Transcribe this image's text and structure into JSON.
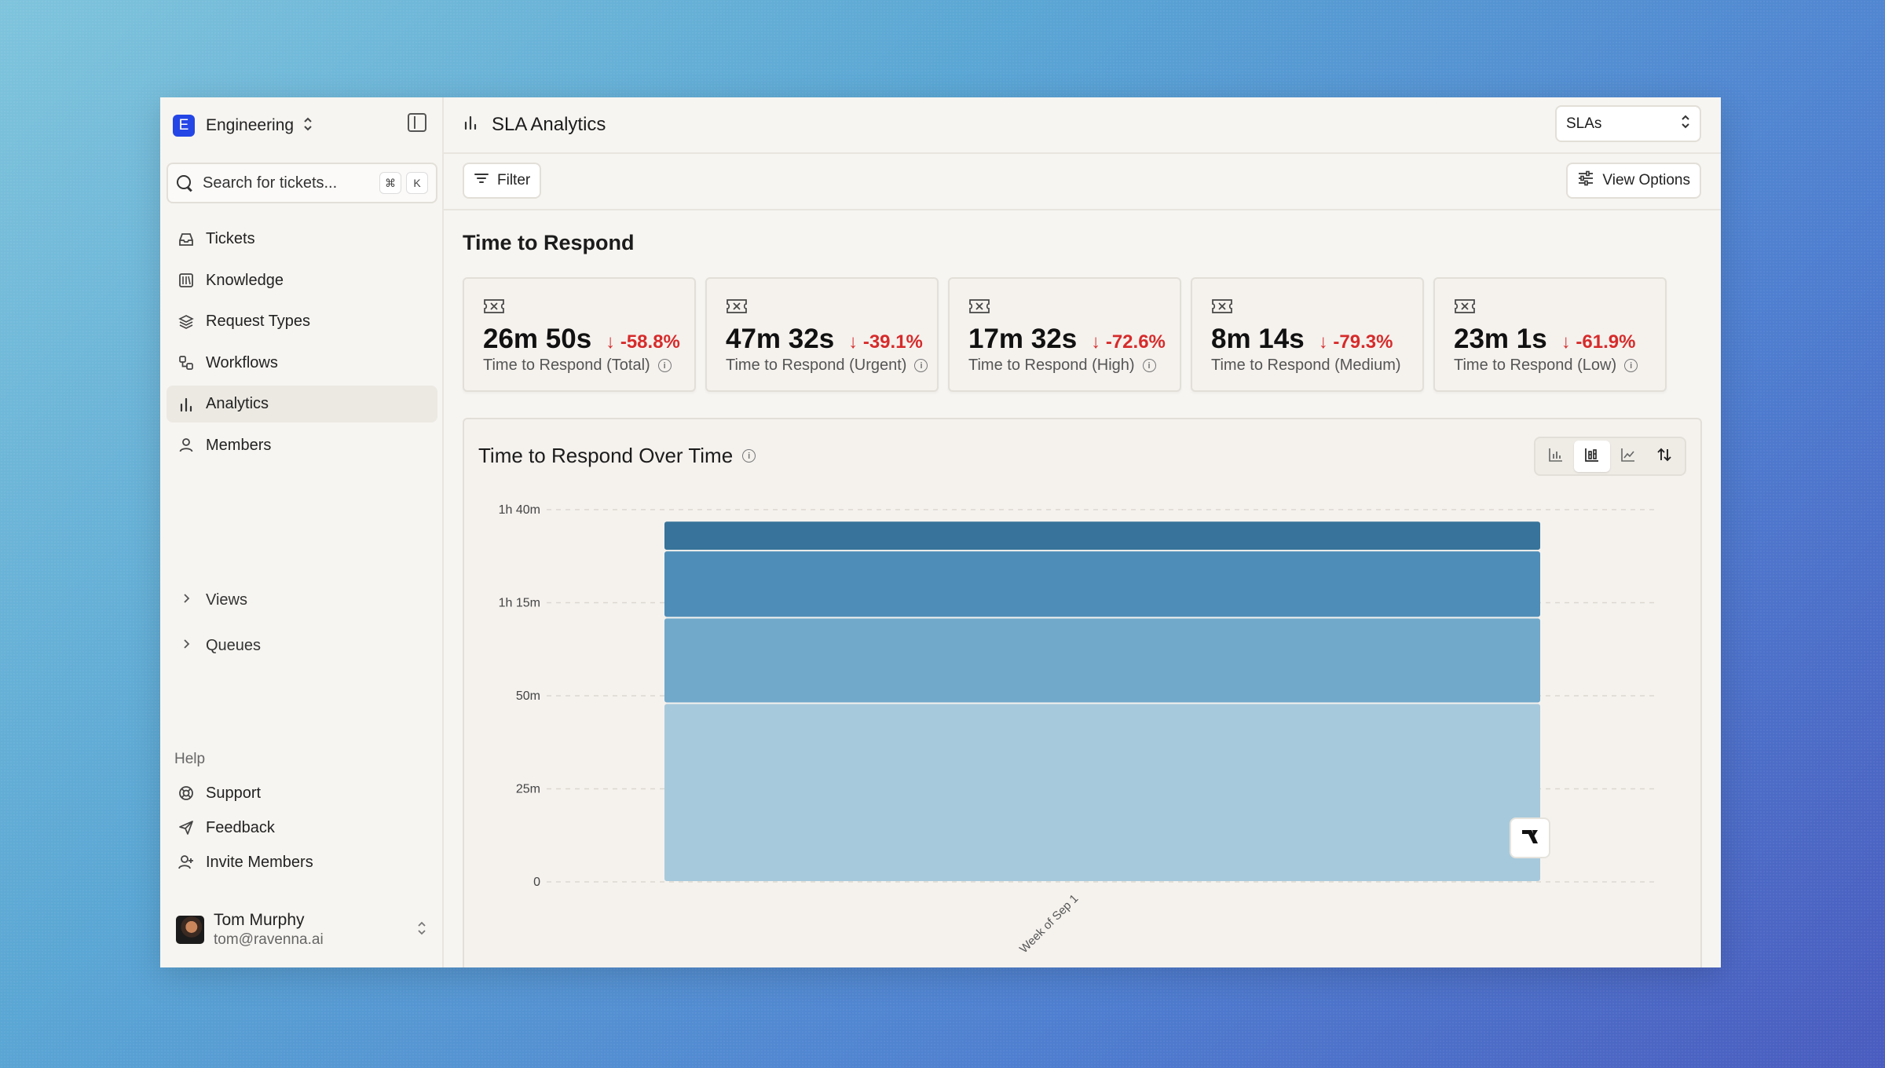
{
  "workspace": {
    "initial": "E",
    "name": "Engineering"
  },
  "search": {
    "placeholder": "Search for tickets...",
    "shortcut_mod": "⌘",
    "shortcut_key": "K"
  },
  "nav": {
    "items": [
      {
        "label": "Tickets",
        "icon": "inbox-icon"
      },
      {
        "label": "Knowledge",
        "icon": "book-icon"
      },
      {
        "label": "Request Types",
        "icon": "layers-icon"
      },
      {
        "label": "Workflows",
        "icon": "workflow-icon"
      },
      {
        "label": "Analytics",
        "icon": "bar-chart-icon",
        "active": true
      },
      {
        "label": "Members",
        "icon": "user-icon"
      }
    ],
    "groups": [
      {
        "label": "Views"
      },
      {
        "label": "Queues"
      }
    ]
  },
  "help": {
    "label": "Help",
    "items": [
      {
        "label": "Support",
        "icon": "lifebuoy-icon"
      },
      {
        "label": "Feedback",
        "icon": "send-icon"
      },
      {
        "label": "Invite Members",
        "icon": "user-plus-icon"
      }
    ]
  },
  "user": {
    "name": "Tom Murphy",
    "email": "tom@ravenna.ai"
  },
  "header": {
    "title": "SLA Analytics",
    "select_value": "SLAs"
  },
  "toolbar": {
    "filter_label": "Filter",
    "view_options_label": "View Options"
  },
  "section": {
    "title": "Time to Respond"
  },
  "cards": [
    {
      "value": "26m 50s",
      "delta": "-58.8%",
      "label": "Time to Respond (Total)"
    },
    {
      "value": "47m 32s",
      "delta": "-39.1%",
      "label": "Time to Respond (Urgent)"
    },
    {
      "value": "17m 32s",
      "delta": "-72.6%",
      "label": "Time to Respond (High)"
    },
    {
      "value": "8m 14s",
      "delta": "-79.3%",
      "label": "Time to Respond (Medium)"
    },
    {
      "value": "23m 1s",
      "delta": "-61.9%",
      "label": "Time to Respond (Low)"
    }
  ],
  "colors": {
    "accent": "#2446e6",
    "negative": "#d62b2b",
    "series": [
      "#a7c9dc",
      "#71a9cb",
      "#4e8db8",
      "#37739a"
    ]
  },
  "chart_panel": {
    "title": "Time to Respond Over Time"
  },
  "chart_data": {
    "type": "bar",
    "stacked": true,
    "categories": [
      "Week of Sep 1"
    ],
    "series": [
      {
        "values": [
          48
        ]
      },
      {
        "values": [
          23
        ]
      },
      {
        "values": [
          18
        ]
      },
      {
        "values": [
          8
        ]
      }
    ],
    "ytick_labels": [
      "0",
      "25m",
      "50m",
      "1h 15m",
      "1h 40m"
    ],
    "ytick_values": [
      0,
      25,
      50,
      75,
      100
    ],
    "ylim": [
      0,
      100
    ],
    "grid": true
  }
}
